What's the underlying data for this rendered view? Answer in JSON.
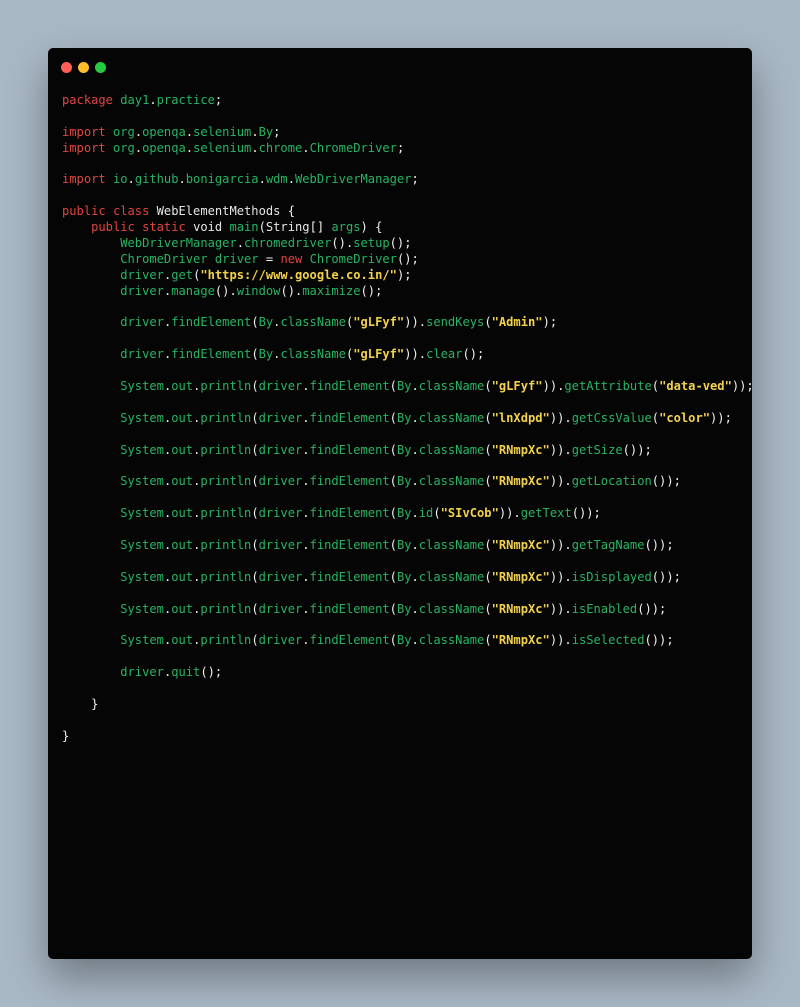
{
  "window": {
    "controls": [
      {
        "name": "close-dot",
        "color": "#ff5f56"
      },
      {
        "name": "minimize-dot",
        "color": "#ffbd2e"
      },
      {
        "name": "zoom-dot",
        "color": "#27c93f"
      }
    ]
  },
  "colors": {
    "keyword": "#e0453f",
    "identifier": "#28b463",
    "plain": "#e6e6e6",
    "string": "#f3d24b",
    "background": "#050505",
    "page_background": "#a9b8c5"
  },
  "code_lines": [
    [
      [
        "kw",
        "package "
      ],
      [
        "id",
        "day1"
      ],
      [
        "punct",
        "."
      ],
      [
        "id",
        "practice"
      ],
      [
        "punct",
        ";"
      ]
    ],
    [],
    [
      [
        "kw",
        "import "
      ],
      [
        "id",
        "org"
      ],
      [
        "punct",
        "."
      ],
      [
        "id",
        "openqa"
      ],
      [
        "punct",
        "."
      ],
      [
        "id",
        "selenium"
      ],
      [
        "punct",
        "."
      ],
      [
        "id",
        "By"
      ],
      [
        "punct",
        ";"
      ]
    ],
    [
      [
        "kw",
        "import "
      ],
      [
        "id",
        "org"
      ],
      [
        "punct",
        "."
      ],
      [
        "id",
        "openqa"
      ],
      [
        "punct",
        "."
      ],
      [
        "id",
        "selenium"
      ],
      [
        "punct",
        "."
      ],
      [
        "id",
        "chrome"
      ],
      [
        "punct",
        "."
      ],
      [
        "id",
        "ChromeDriver"
      ],
      [
        "punct",
        ";"
      ]
    ],
    [],
    [
      [
        "kw",
        "import "
      ],
      [
        "id",
        "io"
      ],
      [
        "punct",
        "."
      ],
      [
        "id",
        "github"
      ],
      [
        "punct",
        "."
      ],
      [
        "id",
        "bonigarcia"
      ],
      [
        "punct",
        "."
      ],
      [
        "id",
        "wdm"
      ],
      [
        "punct",
        "."
      ],
      [
        "id",
        "WebDriverManager"
      ],
      [
        "punct",
        ";"
      ]
    ],
    [],
    [
      [
        "kw",
        "public class "
      ],
      [
        "plain",
        "WebElementMethods "
      ],
      [
        "punct",
        "{"
      ]
    ],
    [
      [
        "ws",
        "    "
      ],
      [
        "kw",
        "public static "
      ],
      [
        "plain",
        "void "
      ],
      [
        "id",
        "main"
      ],
      [
        "punct",
        "("
      ],
      [
        "plain",
        "String"
      ],
      [
        "punct",
        "[] "
      ],
      [
        "id",
        "args"
      ],
      [
        "punct",
        ") {"
      ]
    ],
    [
      [
        "ws",
        "        "
      ],
      [
        "id",
        "WebDriverManager"
      ],
      [
        "punct",
        "."
      ],
      [
        "id",
        "chromedriver"
      ],
      [
        "punct",
        "()."
      ],
      [
        "id",
        "setup"
      ],
      [
        "punct",
        "();"
      ]
    ],
    [
      [
        "ws",
        "        "
      ],
      [
        "id",
        "ChromeDriver driver "
      ],
      [
        "punct",
        "= "
      ],
      [
        "kw",
        "new "
      ],
      [
        "id",
        "ChromeDriver"
      ],
      [
        "punct",
        "();"
      ]
    ],
    [
      [
        "ws",
        "        "
      ],
      [
        "id",
        "driver"
      ],
      [
        "punct",
        "."
      ],
      [
        "id",
        "get"
      ],
      [
        "punct",
        "("
      ],
      [
        "str",
        "\"https://www.google.co.in/\""
      ],
      [
        "punct",
        ");"
      ]
    ],
    [
      [
        "ws",
        "        "
      ],
      [
        "id",
        "driver"
      ],
      [
        "punct",
        "."
      ],
      [
        "id",
        "manage"
      ],
      [
        "punct",
        "()."
      ],
      [
        "id",
        "window"
      ],
      [
        "punct",
        "()."
      ],
      [
        "id",
        "maximize"
      ],
      [
        "punct",
        "();"
      ]
    ],
    [],
    [
      [
        "ws",
        "        "
      ],
      [
        "id",
        "driver"
      ],
      [
        "punct",
        "."
      ],
      [
        "id",
        "findElement"
      ],
      [
        "punct",
        "("
      ],
      [
        "id",
        "By"
      ],
      [
        "punct",
        "."
      ],
      [
        "id",
        "className"
      ],
      [
        "punct",
        "("
      ],
      [
        "str",
        "\"gLFyf\""
      ],
      [
        "punct",
        "))."
      ],
      [
        "id",
        "sendKeys"
      ],
      [
        "punct",
        "("
      ],
      [
        "str",
        "\"Admin\""
      ],
      [
        "punct",
        ");"
      ]
    ],
    [],
    [
      [
        "ws",
        "        "
      ],
      [
        "id",
        "driver"
      ],
      [
        "punct",
        "."
      ],
      [
        "id",
        "findElement"
      ],
      [
        "punct",
        "("
      ],
      [
        "id",
        "By"
      ],
      [
        "punct",
        "."
      ],
      [
        "id",
        "className"
      ],
      [
        "punct",
        "("
      ],
      [
        "str",
        "\"gLFyf\""
      ],
      [
        "punct",
        "))."
      ],
      [
        "id",
        "clear"
      ],
      [
        "punct",
        "();"
      ]
    ],
    [],
    [
      [
        "ws",
        "        "
      ],
      [
        "id",
        "System"
      ],
      [
        "punct",
        "."
      ],
      [
        "id",
        "out"
      ],
      [
        "punct",
        "."
      ],
      [
        "id",
        "println"
      ],
      [
        "punct",
        "("
      ],
      [
        "id",
        "driver"
      ],
      [
        "punct",
        "."
      ],
      [
        "id",
        "findElement"
      ],
      [
        "punct",
        "("
      ],
      [
        "id",
        "By"
      ],
      [
        "punct",
        "."
      ],
      [
        "id",
        "className"
      ],
      [
        "punct",
        "("
      ],
      [
        "str",
        "\"gLFyf\""
      ],
      [
        "punct",
        "))."
      ],
      [
        "id",
        "getAttribute"
      ],
      [
        "punct",
        "("
      ],
      [
        "str",
        "\"data-ved\""
      ],
      [
        "punct",
        "));"
      ]
    ],
    [],
    [
      [
        "ws",
        "        "
      ],
      [
        "id",
        "System"
      ],
      [
        "punct",
        "."
      ],
      [
        "id",
        "out"
      ],
      [
        "punct",
        "."
      ],
      [
        "id",
        "println"
      ],
      [
        "punct",
        "("
      ],
      [
        "id",
        "driver"
      ],
      [
        "punct",
        "."
      ],
      [
        "id",
        "findElement"
      ],
      [
        "punct",
        "("
      ],
      [
        "id",
        "By"
      ],
      [
        "punct",
        "."
      ],
      [
        "id",
        "className"
      ],
      [
        "punct",
        "("
      ],
      [
        "str",
        "\"lnXdpd\""
      ],
      [
        "punct",
        "))."
      ],
      [
        "id",
        "getCssValue"
      ],
      [
        "punct",
        "("
      ],
      [
        "str",
        "\"color\""
      ],
      [
        "punct",
        "));"
      ]
    ],
    [],
    [
      [
        "ws",
        "        "
      ],
      [
        "id",
        "System"
      ],
      [
        "punct",
        "."
      ],
      [
        "id",
        "out"
      ],
      [
        "punct",
        "."
      ],
      [
        "id",
        "println"
      ],
      [
        "punct",
        "("
      ],
      [
        "id",
        "driver"
      ],
      [
        "punct",
        "."
      ],
      [
        "id",
        "findElement"
      ],
      [
        "punct",
        "("
      ],
      [
        "id",
        "By"
      ],
      [
        "punct",
        "."
      ],
      [
        "id",
        "className"
      ],
      [
        "punct",
        "("
      ],
      [
        "str",
        "\"RNmpXc\""
      ],
      [
        "punct",
        "))."
      ],
      [
        "id",
        "getSize"
      ],
      [
        "punct",
        "());"
      ]
    ],
    [],
    [
      [
        "ws",
        "        "
      ],
      [
        "id",
        "System"
      ],
      [
        "punct",
        "."
      ],
      [
        "id",
        "out"
      ],
      [
        "punct",
        "."
      ],
      [
        "id",
        "println"
      ],
      [
        "punct",
        "("
      ],
      [
        "id",
        "driver"
      ],
      [
        "punct",
        "."
      ],
      [
        "id",
        "findElement"
      ],
      [
        "punct",
        "("
      ],
      [
        "id",
        "By"
      ],
      [
        "punct",
        "."
      ],
      [
        "id",
        "className"
      ],
      [
        "punct",
        "("
      ],
      [
        "str",
        "\"RNmpXc\""
      ],
      [
        "punct",
        "))."
      ],
      [
        "id",
        "getLocation"
      ],
      [
        "punct",
        "());"
      ]
    ],
    [],
    [
      [
        "ws",
        "        "
      ],
      [
        "id",
        "System"
      ],
      [
        "punct",
        "."
      ],
      [
        "id",
        "out"
      ],
      [
        "punct",
        "."
      ],
      [
        "id",
        "println"
      ],
      [
        "punct",
        "("
      ],
      [
        "id",
        "driver"
      ],
      [
        "punct",
        "."
      ],
      [
        "id",
        "findElement"
      ],
      [
        "punct",
        "("
      ],
      [
        "id",
        "By"
      ],
      [
        "punct",
        "."
      ],
      [
        "id",
        "id"
      ],
      [
        "punct",
        "("
      ],
      [
        "str",
        "\"SIvCob\""
      ],
      [
        "punct",
        "))."
      ],
      [
        "id",
        "getText"
      ],
      [
        "punct",
        "());"
      ]
    ],
    [],
    [
      [
        "ws",
        "        "
      ],
      [
        "id",
        "System"
      ],
      [
        "punct",
        "."
      ],
      [
        "id",
        "out"
      ],
      [
        "punct",
        "."
      ],
      [
        "id",
        "println"
      ],
      [
        "punct",
        "("
      ],
      [
        "id",
        "driver"
      ],
      [
        "punct",
        "."
      ],
      [
        "id",
        "findElement"
      ],
      [
        "punct",
        "("
      ],
      [
        "id",
        "By"
      ],
      [
        "punct",
        "."
      ],
      [
        "id",
        "className"
      ],
      [
        "punct",
        "("
      ],
      [
        "str",
        "\"RNmpXc\""
      ],
      [
        "punct",
        "))."
      ],
      [
        "id",
        "getTagName"
      ],
      [
        "punct",
        "());"
      ]
    ],
    [],
    [
      [
        "ws",
        "        "
      ],
      [
        "id",
        "System"
      ],
      [
        "punct",
        "."
      ],
      [
        "id",
        "out"
      ],
      [
        "punct",
        "."
      ],
      [
        "id",
        "println"
      ],
      [
        "punct",
        "("
      ],
      [
        "id",
        "driver"
      ],
      [
        "punct",
        "."
      ],
      [
        "id",
        "findElement"
      ],
      [
        "punct",
        "("
      ],
      [
        "id",
        "By"
      ],
      [
        "punct",
        "."
      ],
      [
        "id",
        "className"
      ],
      [
        "punct",
        "("
      ],
      [
        "str",
        "\"RNmpXc\""
      ],
      [
        "punct",
        "))."
      ],
      [
        "id",
        "isDisplayed"
      ],
      [
        "punct",
        "());"
      ]
    ],
    [],
    [
      [
        "ws",
        "        "
      ],
      [
        "id",
        "System"
      ],
      [
        "punct",
        "."
      ],
      [
        "id",
        "out"
      ],
      [
        "punct",
        "."
      ],
      [
        "id",
        "println"
      ],
      [
        "punct",
        "("
      ],
      [
        "id",
        "driver"
      ],
      [
        "punct",
        "."
      ],
      [
        "id",
        "findElement"
      ],
      [
        "punct",
        "("
      ],
      [
        "id",
        "By"
      ],
      [
        "punct",
        "."
      ],
      [
        "id",
        "className"
      ],
      [
        "punct",
        "("
      ],
      [
        "str",
        "\"RNmpXc\""
      ],
      [
        "punct",
        "))."
      ],
      [
        "id",
        "isEnabled"
      ],
      [
        "punct",
        "());"
      ]
    ],
    [],
    [
      [
        "ws",
        "        "
      ],
      [
        "id",
        "System"
      ],
      [
        "punct",
        "."
      ],
      [
        "id",
        "out"
      ],
      [
        "punct",
        "."
      ],
      [
        "id",
        "println"
      ],
      [
        "punct",
        "("
      ],
      [
        "id",
        "driver"
      ],
      [
        "punct",
        "."
      ],
      [
        "id",
        "findElement"
      ],
      [
        "punct",
        "("
      ],
      [
        "id",
        "By"
      ],
      [
        "punct",
        "."
      ],
      [
        "id",
        "className"
      ],
      [
        "punct",
        "("
      ],
      [
        "str",
        "\"RNmpXc\""
      ],
      [
        "punct",
        "))."
      ],
      [
        "id",
        "isSelected"
      ],
      [
        "punct",
        "());"
      ]
    ],
    [],
    [
      [
        "ws",
        "        "
      ],
      [
        "id",
        "driver"
      ],
      [
        "punct",
        "."
      ],
      [
        "id",
        "quit"
      ],
      [
        "punct",
        "();"
      ]
    ],
    [],
    [
      [
        "ws",
        "    "
      ],
      [
        "punct",
        "}"
      ]
    ],
    [],
    [
      [
        "punct",
        "}"
      ]
    ]
  ]
}
